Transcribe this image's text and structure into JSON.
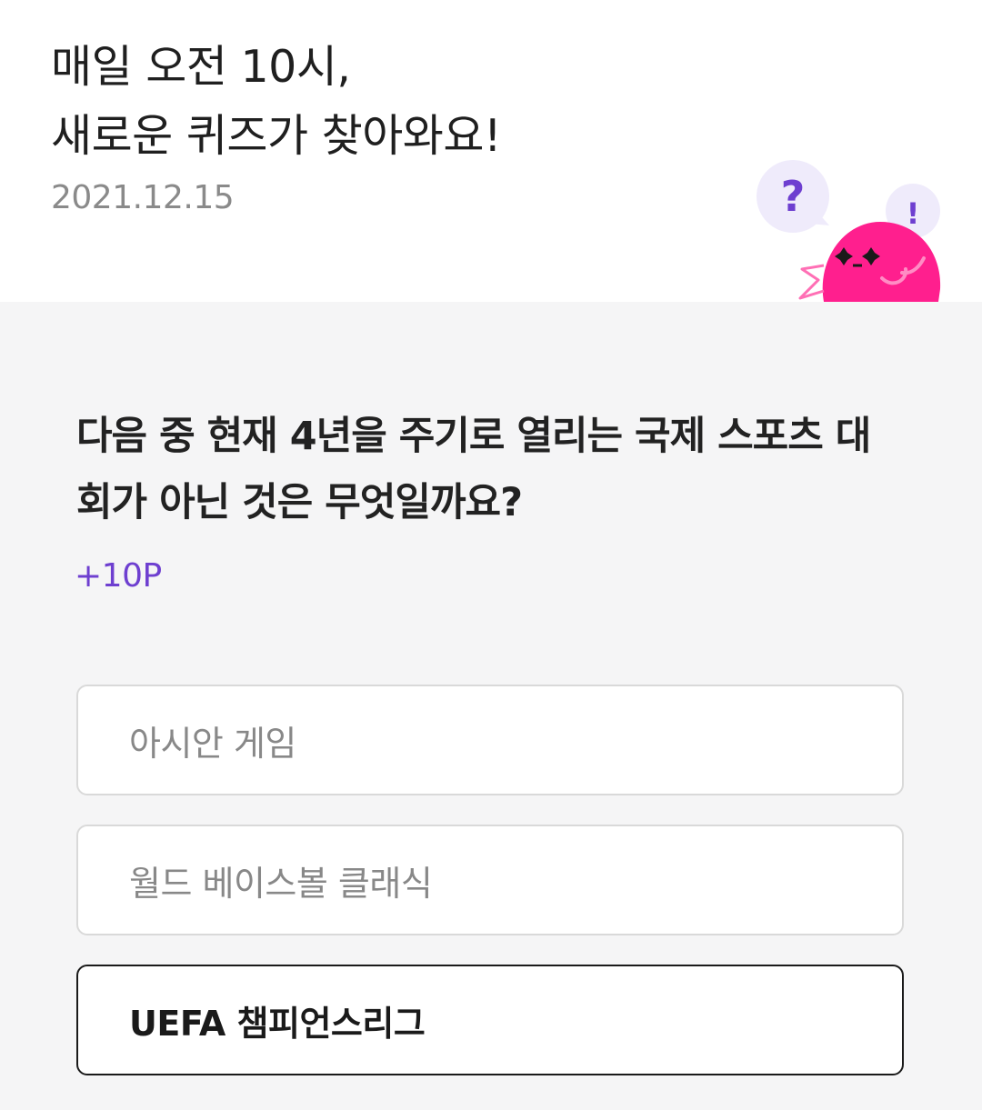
{
  "header": {
    "title_line1": "매일 오전 10시,",
    "title_line2": "새로운 퀴즈가 찾아와요!",
    "date": "2021.12.15",
    "bubble_question": "?",
    "bubble_exclaim": "!"
  },
  "quiz": {
    "question": "다음 중 현재 4년을 주기로 열리는 국제 스포츠 대회가 아닌 것은 무엇일까요?",
    "points": "+10P",
    "options": [
      {
        "label": "아시안 게임",
        "selected": false
      },
      {
        "label": "월드 베이스볼 클래식",
        "selected": false
      },
      {
        "label": "UEFA 챔피언스리그",
        "selected": true
      }
    ]
  },
  "colors": {
    "accent_purple": "#6e3fd0",
    "mascot_pink": "#ff1f8e",
    "selected_border": "#1a1a1a"
  }
}
